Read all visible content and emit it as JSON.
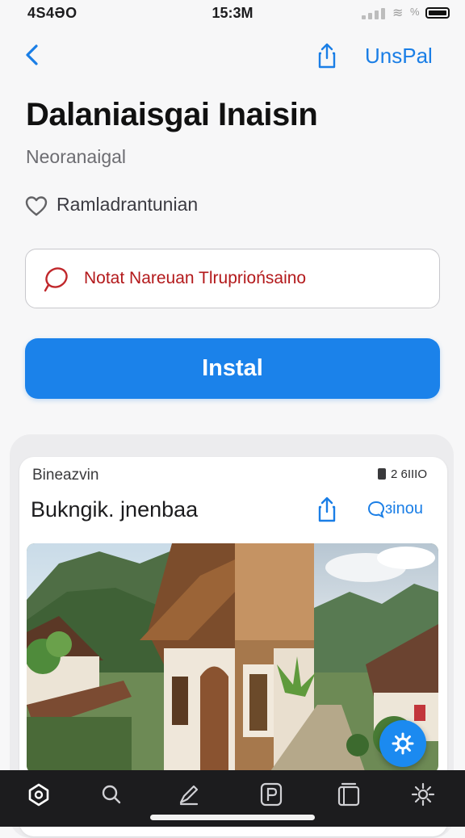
{
  "status_bar": {
    "carrier": "4S4ƏO",
    "time": "15:3M",
    "battery_percent": "%"
  },
  "nav": {
    "right_label": "UnsPal"
  },
  "header": {
    "title": "Dalaniaisgai Inaisin",
    "subtitle": "Neoranaigal",
    "favorite_label": "Ramladrantunian"
  },
  "alert": {
    "text": "Notat Nareuan Tlrupriońsaino"
  },
  "install_button": {
    "label": "Instal"
  },
  "card": {
    "label": "Bineazvin",
    "stat": "2 6ΙΙΙΟ",
    "title": "Bukngik. jnenbaa",
    "link_label": "ɜinou"
  },
  "tabbar": {
    "items": [
      "home",
      "search",
      "updates",
      "parking",
      "library",
      "settings"
    ]
  },
  "colors": {
    "accent": "#1b82ea",
    "alert_text": "#b3191b",
    "tab_bar": "#1c1c1e"
  }
}
